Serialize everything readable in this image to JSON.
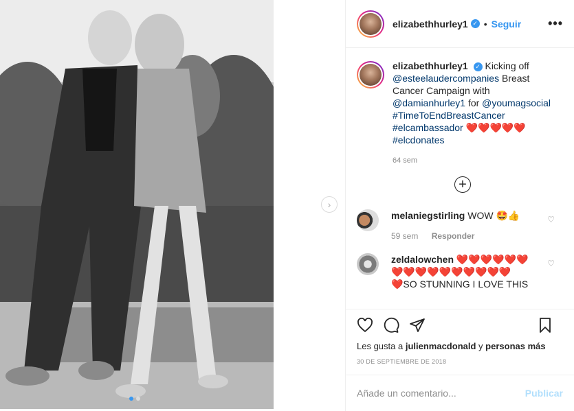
{
  "post": {
    "username": "elizabethhurley1",
    "follow_label": "Seguir",
    "more_label": "•••",
    "next_label": "›"
  },
  "caption": {
    "username": "elizabethhurley1",
    "text_1": "Kicking off",
    "mention_1": "@esteelaudercompanies",
    "text_2": "Breast Cancer Campaign with",
    "mention_2": "@damianhurley1",
    "text_3": "for",
    "mention_3": "@youmagsocial",
    "hashtag_1": "#TimeToEndBreastCancer",
    "hashtag_2": "#elcambassador",
    "hearts": "❤️❤️❤️❤️❤️",
    "hashtag_3": "#elcdonates",
    "time": "64 sem"
  },
  "load_more_label": "+",
  "comments": [
    {
      "username": "melaniegstirling",
      "text": "WOW 🤩👍",
      "time": "59 sem",
      "reply_label": "Responder"
    },
    {
      "username": "zeldalowchen",
      "hearts_1": "❤️❤️❤️❤️❤️❤️",
      "hearts_2": "❤️❤️❤️❤️❤️❤️❤️❤️❤️❤️",
      "text": "❤️SO STUNNING I LOVE THIS"
    }
  ],
  "likes": {
    "prefix": "Les gusta a",
    "user": "julienmacdonald",
    "middle": "y",
    "others": "personas más"
  },
  "date": "30 DE SEPTIEMBRE DE 2018",
  "add_comment": {
    "placeholder": "Añade un comentario...",
    "publish_label": "Publicar"
  },
  "colors": {
    "accent": "#3897f0",
    "link": "#00376b",
    "muted": "#8e8e8e",
    "publish_disabled": "#b2dffc"
  },
  "icons": {
    "like": "heart-icon",
    "comment": "comment-icon",
    "share": "paper-plane-icon",
    "save": "bookmark-icon",
    "verified": "verified-badge-icon"
  }
}
